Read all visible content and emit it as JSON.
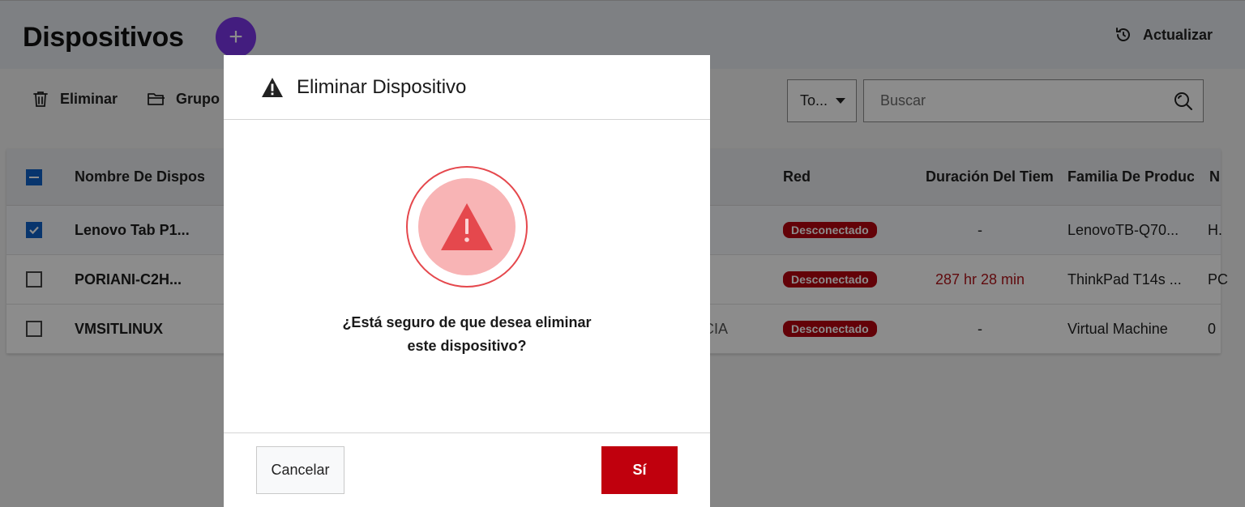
{
  "header": {
    "title": "Dispositivos",
    "add_label": "+",
    "refresh_label": "Actualizar"
  },
  "toolbar": {
    "delete_label": "Eliminar",
    "group_label": "Grupo",
    "filter_value": "To...",
    "search_placeholder": "Buscar"
  },
  "table": {
    "columns": [
      "Nombre De Disposit",
      "Red",
      "Duración Del Tiemp",
      "Familia De Productc",
      "N"
    ],
    "rows": [
      {
        "checked": true,
        "name": "Lenovo Tab P1...",
        "extra": "",
        "network": "Desconectado",
        "duration": "-",
        "family": "LenovoTB-Q70...",
        "n": "H."
      },
      {
        "checked": false,
        "name": "PORIANI-C2H...",
        "extra": "",
        "network": "Desconectado",
        "duration": "287 hr 28 min",
        "family": "ThinkPad T14s ...",
        "n": "PC"
      },
      {
        "checked": false,
        "name": "VMSITLINUX",
        "extra": "CIA",
        "network": "Desconectado",
        "duration": "-",
        "family": "Virtual Machine",
        "n": "0"
      }
    ]
  },
  "modal": {
    "title": "Eliminar Dispositivo",
    "message": "¿Está seguro de que desea eliminar este dispositivo?",
    "cancel_label": "Cancelar",
    "confirm_label": "Sí"
  },
  "colors": {
    "accent_purple": "#7b36e8",
    "danger_red": "#c0000d",
    "badge_red": "#b5050f",
    "alert_pink": "#f8b4b5",
    "checkbox_blue": "#0f62c7"
  },
  "icons": {
    "refresh": "refresh-icon",
    "delete": "trash-icon",
    "group": "folder-icon",
    "search": "search-icon",
    "warning": "warning-icon"
  }
}
